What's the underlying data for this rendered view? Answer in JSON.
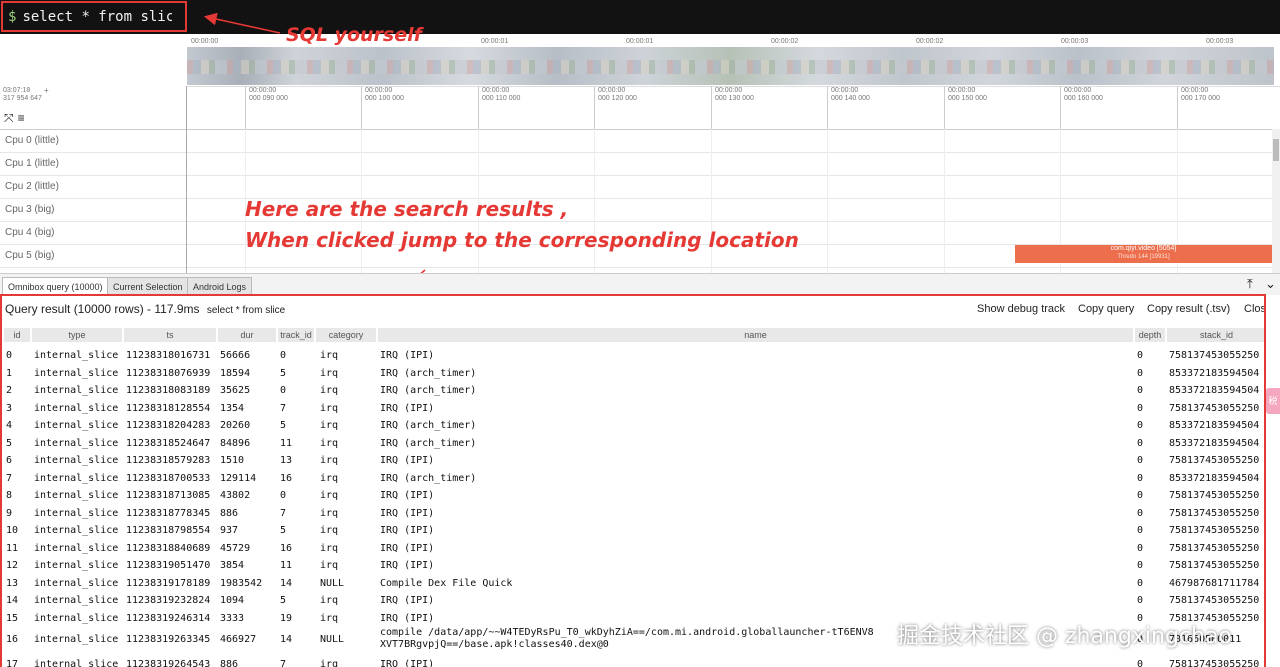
{
  "omnibox": {
    "prompt": "$",
    "query": "select * from slice"
  },
  "annotations": {
    "sql": "SQL yourself",
    "results_line1": "Here are the search results ,",
    "results_line2": "When clicked jump to the corresponding location"
  },
  "overview_ticks": [
    "00:00:00",
    "00:00:01",
    "00:00:01",
    "00:00:02",
    "00:00:02",
    "00:00:03",
    "00:00:03"
  ],
  "time_axis": {
    "offset_time": "03:07:18",
    "offset_ns": "317 954 647",
    "plus": "+",
    "ticks": [
      {
        "t": "00:00:00",
        "ns": "000 090 000"
      },
      {
        "t": "00:00:00",
        "ns": "000 100 000"
      },
      {
        "t": "00:00:00",
        "ns": "000 110 000"
      },
      {
        "t": "00:00:00",
        "ns": "000 120 000"
      },
      {
        "t": "00:00:00",
        "ns": "000 130 000"
      },
      {
        "t": "00:00:00",
        "ns": "000 140 000"
      },
      {
        "t": "00:00:00",
        "ns": "000 150 000"
      },
      {
        "t": "00:00:00",
        "ns": "000 160 000"
      },
      {
        "t": "00:00:00",
        "ns": "000 170 000"
      }
    ]
  },
  "tracks": [
    "Cpu 0 (little)",
    "Cpu 1 (little)",
    "Cpu 2 (little)",
    "Cpu 3 (big)",
    "Cpu 4 (big)",
    "Cpu 5 (big)"
  ],
  "slice": {
    "title": "com.qiyi.video [5054]",
    "subtitle": "Thredo 144 [19931]"
  },
  "tabs": [
    "Omnibox query (10000)",
    "Current Selection",
    "Android Logs"
  ],
  "tab_controls": {
    "pin": "⤒",
    "collapse": "⌄"
  },
  "query_result": {
    "title": "Query result (10000 rows) - 117.9ms",
    "sql": "select * from slice",
    "buttons": [
      "Show debug track",
      "Copy query",
      "Copy result (.tsv)",
      "Close"
    ],
    "columns": [
      "id",
      "type",
      "ts",
      "dur",
      "track_id",
      "category",
      "name",
      "depth",
      "stack_id"
    ],
    "rows": [
      [
        "0",
        "internal_slice",
        "11238318016731",
        "56666",
        "0",
        "irq",
        "IRQ (IPI)",
        "0",
        "758137453055250"
      ],
      [
        "1",
        "internal_slice",
        "11238318076939",
        "18594",
        "5",
        "irq",
        "IRQ (arch_timer)",
        "0",
        "853372183594504"
      ],
      [
        "2",
        "internal_slice",
        "11238318083189",
        "35625",
        "0",
        "irq",
        "IRQ (arch_timer)",
        "0",
        "853372183594504"
      ],
      [
        "3",
        "internal_slice",
        "11238318128554",
        "1354",
        "7",
        "irq",
        "IRQ (IPI)",
        "0",
        "758137453055250"
      ],
      [
        "4",
        "internal_slice",
        "11238318204283",
        "20260",
        "5",
        "irq",
        "IRQ (arch_timer)",
        "0",
        "853372183594504"
      ],
      [
        "5",
        "internal_slice",
        "11238318524647",
        "84896",
        "11",
        "irq",
        "IRQ (arch_timer)",
        "0",
        "853372183594504"
      ],
      [
        "6",
        "internal_slice",
        "11238318579283",
        "1510",
        "13",
        "irq",
        "IRQ (IPI)",
        "0",
        "758137453055250"
      ],
      [
        "7",
        "internal_slice",
        "11238318700533",
        "129114",
        "16",
        "irq",
        "IRQ (arch_timer)",
        "0",
        "853372183594504"
      ],
      [
        "8",
        "internal_slice",
        "11238318713085",
        "43802",
        "0",
        "irq",
        "IRQ (IPI)",
        "0",
        "758137453055250"
      ],
      [
        "9",
        "internal_slice",
        "11238318778345",
        "886",
        "7",
        "irq",
        "IRQ (IPI)",
        "0",
        "758137453055250"
      ],
      [
        "10",
        "internal_slice",
        "11238318798554",
        "937",
        "5",
        "irq",
        "IRQ (IPI)",
        "0",
        "758137453055250"
      ],
      [
        "11",
        "internal_slice",
        "11238318840689",
        "45729",
        "16",
        "irq",
        "IRQ (IPI)",
        "0",
        "758137453055250"
      ],
      [
        "12",
        "internal_slice",
        "11238319051470",
        "3854",
        "11",
        "irq",
        "IRQ (IPI)",
        "0",
        "758137453055250"
      ],
      [
        "13",
        "internal_slice",
        "11238319178189",
        "1983542",
        "14",
        "NULL",
        "Compile Dex File Quick",
        "0",
        "467987681711784"
      ],
      [
        "14",
        "internal_slice",
        "11238319232824",
        "1094",
        "5",
        "irq",
        "IRQ (IPI)",
        "0",
        "758137453055250"
      ],
      [
        "15",
        "internal_slice",
        "11238319246314",
        "3333",
        "19",
        "irq",
        "IRQ (IPI)",
        "0",
        "758137453055250"
      ],
      [
        "16",
        "internal_slice",
        "11238319263345",
        "466927",
        "14",
        "NULL",
        "compile /data/app/~~W4TEDyRsPu_T0_wkDyhZiA==/com.mi.android.globallauncher-tT6ENV8",
        "0",
        "701660500011"
      ],
      [
        "17",
        "internal_slice",
        "11238319264543",
        "886",
        "7",
        "irq",
        "IRQ (IPI)",
        "0",
        "758137453055250"
      ]
    ],
    "row16_name_line2": "XVT7BRgvpjQ==/base.apk!classes40.dex@0"
  },
  "watermark": "掘金技术社区 @ zhangxingchao",
  "side_badge": "税"
}
